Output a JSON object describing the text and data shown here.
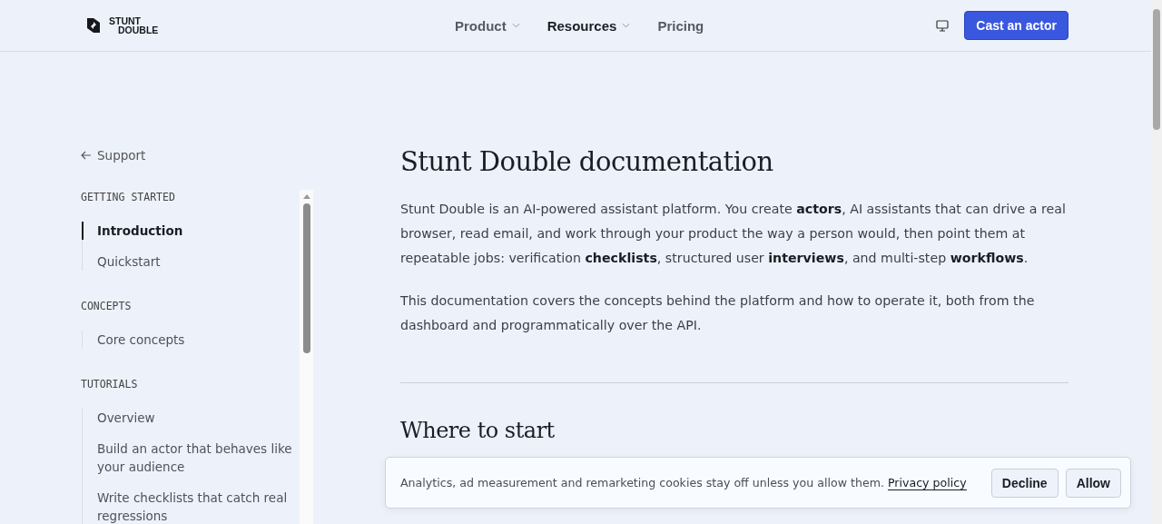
{
  "header": {
    "logo": {
      "line_1": "STUNT",
      "line_2": "DOUBLE"
    },
    "nav": [
      {
        "label": "Product",
        "has_menu": true,
        "selected": false
      },
      {
        "label": "Resources",
        "has_menu": true,
        "selected": true
      },
      {
        "label": "Pricing",
        "has_menu": false,
        "selected": false
      }
    ],
    "cta": "Cast an actor"
  },
  "sidebar": {
    "back_link": "Support",
    "sections": [
      {
        "heading": "GETTING STARTED",
        "items": [
          {
            "label": "Introduction",
            "selected": true
          },
          {
            "label": "Quickstart",
            "selected": false
          }
        ]
      },
      {
        "heading": "CONCEPTS",
        "items": [
          {
            "label": "Core concepts",
            "selected": false
          }
        ]
      },
      {
        "heading": "TUTORIALS",
        "items": [
          {
            "label": "Overview",
            "selected": false
          },
          {
            "label": "Build an actor that behaves like your audience",
            "selected": false
          },
          {
            "label": "Write checklists that catch real regressions",
            "selected": false
          }
        ]
      }
    ]
  },
  "main": {
    "title": "Stunt Double documentation",
    "paragraphs": [
      "Stunt Double is an AI-powered assistant platform. You create **actors**, AI assistants that can drive a real browser, read email, and work through your product the way a person would, then point them at repeatable jobs: verification **checklists**, structured user **interviews**, and multi-step **workflows**.",
      "This documentation covers the concepts behind the platform and how to operate it, both from the dashboard and programmatically over the API."
    ],
    "section_heading": "Where to start"
  },
  "cookie_banner": {
    "text": "Analytics, ad measurement and remarketing cookies stay off unless you allow them.",
    "link": "Privacy policy",
    "buttons": [
      "Decline",
      "Allow"
    ]
  }
}
